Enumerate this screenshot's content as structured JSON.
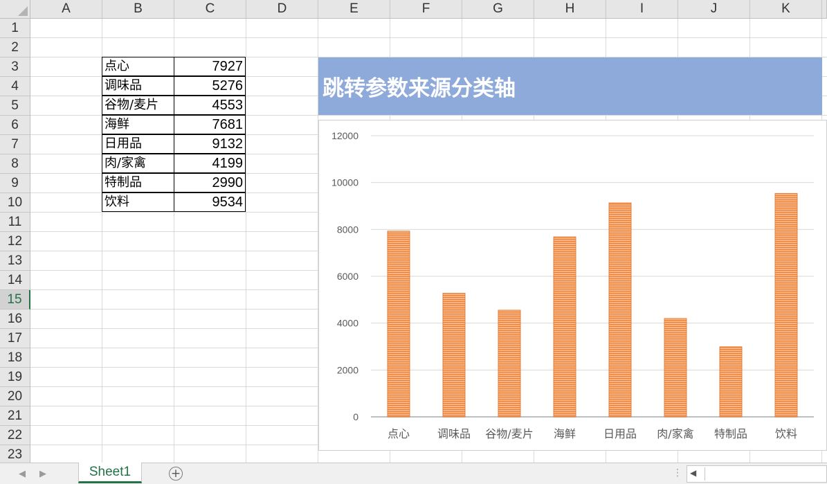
{
  "sheet": {
    "columns": [
      "A",
      "B",
      "C",
      "D",
      "E",
      "F",
      "G",
      "H",
      "I",
      "J",
      "K"
    ],
    "rows": [
      "1",
      "2",
      "3",
      "4",
      "5",
      "6",
      "7",
      "8",
      "9",
      "10",
      "11",
      "12",
      "13",
      "14",
      "15",
      "16",
      "17",
      "18",
      "19",
      "20",
      "21",
      "22",
      "23"
    ],
    "active_row": "15"
  },
  "table": [
    {
      "name": "点心",
      "value": "7927"
    },
    {
      "name": "调味品",
      "value": "5276"
    },
    {
      "name": "谷物/麦片",
      "value": "4553"
    },
    {
      "name": "海鲜",
      "value": "7681"
    },
    {
      "name": "日用品",
      "value": "9132"
    },
    {
      "name": "肉/家禽",
      "value": "4199"
    },
    {
      "name": "特制品",
      "value": "2990"
    },
    {
      "name": "饮料",
      "value": "9534"
    }
  ],
  "chart_title": "跳转参数来源分类轴",
  "chart_data": {
    "type": "bar",
    "categories": [
      "点心",
      "调味品",
      "谷物/麦片",
      "海鲜",
      "日用品",
      "肉/家禽",
      "特制品",
      "饮料"
    ],
    "values": [
      7927,
      5276,
      4553,
      7681,
      9132,
      4199,
      2990,
      9534
    ],
    "ylim": [
      0,
      12000
    ],
    "yticks": [
      0,
      2000,
      4000,
      6000,
      8000,
      10000,
      12000
    ],
    "grid": true,
    "bar_color": "#f4a460",
    "bar_stripe_color": "#ed7d31"
  },
  "tabs": {
    "sheet_name": "Sheet1",
    "add_icon": "+",
    "prev_icon": "◀",
    "next_icon": "▶",
    "splitter_icon": "⋮",
    "scroll_left_icon": "◀"
  }
}
